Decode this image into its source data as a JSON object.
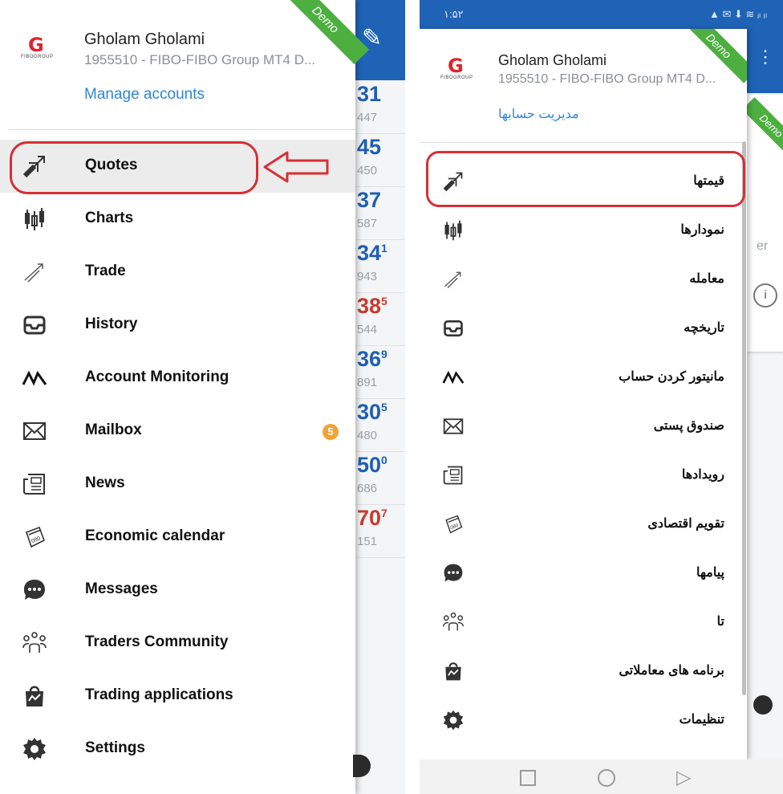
{
  "left": {
    "account": {
      "name": "Gholam Gholami",
      "details": "1955510 - FIBO-FIBO Group MT4 D...",
      "manage_label": "Manage accounts",
      "logo_text": "FIBOGROUP",
      "ribbon": "Demo"
    },
    "menu": [
      {
        "label": "Quotes",
        "icon": "quotes-icon"
      },
      {
        "label": "Charts",
        "icon": "charts-icon"
      },
      {
        "label": "Trade",
        "icon": "trade-icon"
      },
      {
        "label": "History",
        "icon": "history-icon"
      },
      {
        "label": "Account Monitoring",
        "icon": "account-monitoring-icon"
      },
      {
        "label": "Mailbox",
        "icon": "mailbox-icon",
        "badge": "5"
      },
      {
        "label": "News",
        "icon": "news-icon"
      },
      {
        "label": "Economic calendar",
        "icon": "economic-calendar-icon"
      },
      {
        "label": "Messages",
        "icon": "messages-icon"
      },
      {
        "label": "Traders Community",
        "icon": "traders-community-icon"
      },
      {
        "label": "Trading applications",
        "icon": "trading-applications-icon"
      },
      {
        "label": "Settings",
        "icon": "settings-icon"
      }
    ],
    "background_quotes": [
      {
        "big": "31",
        "small": "447",
        "color": "#1f5fb4"
      },
      {
        "big": "45",
        "small": "450",
        "color": "#1f5fb4"
      },
      {
        "big": "37",
        "small": "587",
        "color": "#1f5fb4"
      },
      {
        "big": "34",
        "sup": "1",
        "small": "943",
        "color": "#1f5fb4"
      },
      {
        "big": "38",
        "sup": "5",
        "small": "544",
        "color": "#c93a2e"
      },
      {
        "big": "36",
        "sup": "9",
        "small": "891",
        "color": "#1f5fb4"
      },
      {
        "big": "30",
        "sup": "5",
        "small": "480",
        "color": "#1f5fb4"
      },
      {
        "big": "50",
        "sup": "0",
        "small": "686",
        "color": "#1f5fb4"
      },
      {
        "big": "70",
        "sup": "7",
        "small": "151",
        "color": "#c93a2e"
      }
    ]
  },
  "right": {
    "status": {
      "time": "۱:۵۲",
      "icons": "▲ ✉ ⬇ ≋ ᵢₗ ᵢₗ"
    },
    "account": {
      "name": "Gholam Gholami",
      "details": "1955510 - FIBO-FIBO Group MT4 D...",
      "manage_label": "مدیریت حسابها",
      "logo_text": "FIBOGROUP",
      "ribbon": "Demo",
      "ribbon2": "Demo"
    },
    "menu": [
      {
        "label": "قیمتها",
        "icon": "quotes-icon"
      },
      {
        "label": "نمودارها",
        "icon": "charts-icon"
      },
      {
        "label": "معامله",
        "icon": "trade-icon"
      },
      {
        "label": "تاریخچه",
        "icon": "history-icon"
      },
      {
        "label": "مانیتور کردن حساب",
        "icon": "account-monitoring-icon"
      },
      {
        "label": "صندوق پستی",
        "icon": "mailbox-icon"
      },
      {
        "label": "رویدادها",
        "icon": "news-icon"
      },
      {
        "label": "تقویم اقتصادی",
        "icon": "economic-calendar-icon"
      },
      {
        "label": "پیامها",
        "icon": "messages-icon"
      },
      {
        "label": "تا",
        "icon": "traders-community-icon"
      },
      {
        "label": "برنامه های معاملاتی",
        "icon": "trading-applications-icon"
      },
      {
        "label": "تنظیمات",
        "icon": "settings-icon"
      }
    ],
    "bg_text": "er"
  },
  "colors": {
    "accent": "#1f63b6",
    "highlight": "#d62f36",
    "link": "#2f86d6",
    "badge": "#f2a334",
    "ribbon": "#4caf3f"
  }
}
